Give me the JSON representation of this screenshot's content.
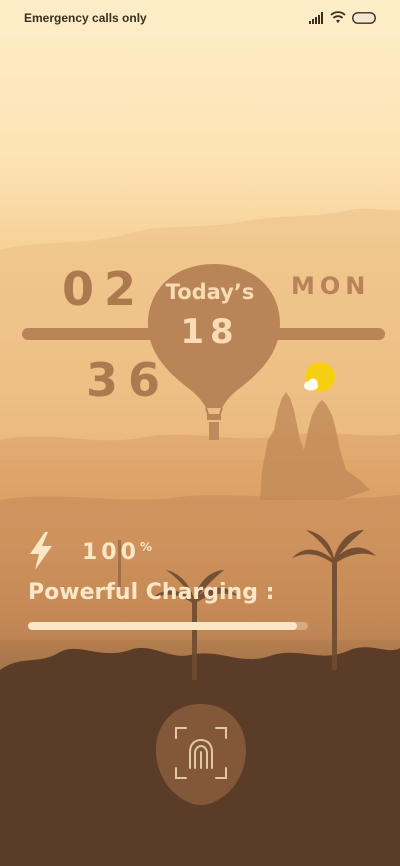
{
  "status_bar": {
    "carrier_text": "Emergency calls only",
    "signal_icon": "signal-icon",
    "wifi_icon": "wifi-icon",
    "battery_icon": "battery-icon"
  },
  "clock": {
    "hour": "02",
    "minute": "36",
    "weekday": "MON",
    "today_label": "Today’s",
    "day_number": "18"
  },
  "weather": {
    "icon": "partly-sunny-icon",
    "sun_color": "#f7cf12"
  },
  "charging": {
    "icon": "lightning-bolt-icon",
    "percent_value": "100",
    "percent_sign": "%",
    "label": "Powerful Charging :",
    "progress": 0.96
  },
  "unlock": {
    "icon": "fingerprint-icon"
  },
  "colors": {
    "accent": "#b98458",
    "text_light": "#fbe6c6"
  }
}
